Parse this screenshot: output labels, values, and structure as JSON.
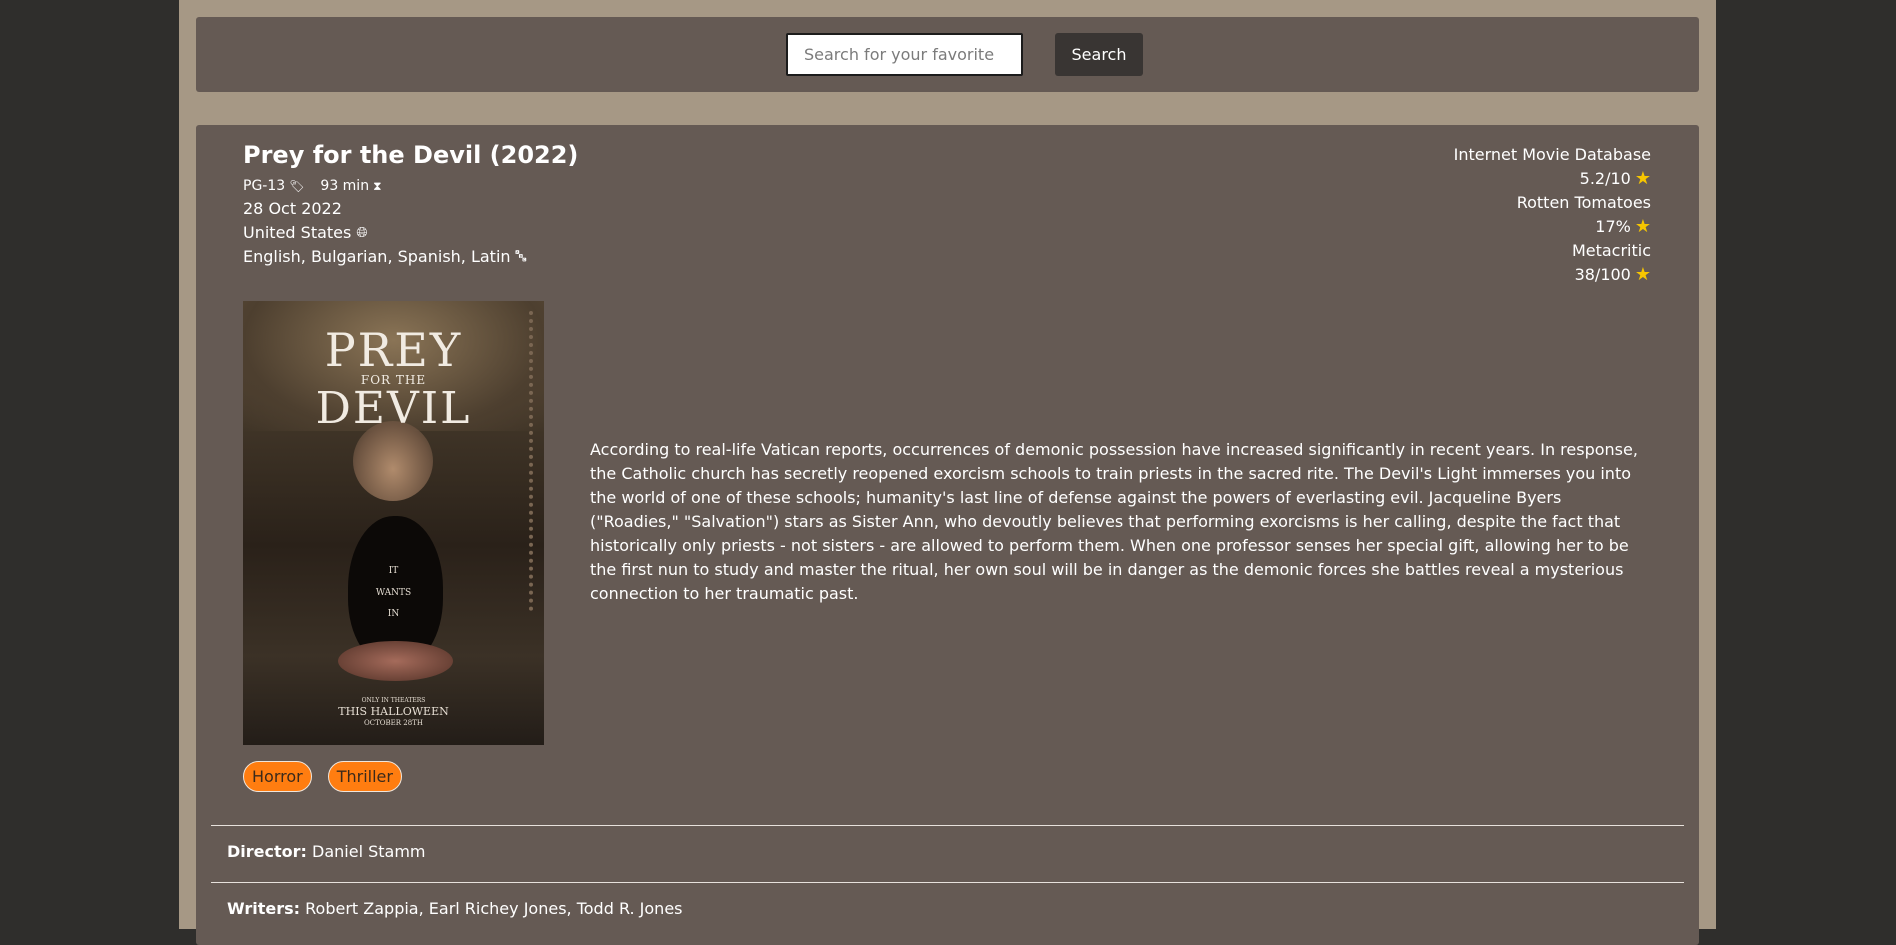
{
  "search": {
    "placeholder": "Search for your favorite",
    "value": "",
    "button_label": "Search"
  },
  "movie": {
    "title": "Prey for the Devil (2022)",
    "rated": "PG-13",
    "runtime": "93 min",
    "released": "28 Oct 2022",
    "country": "United States",
    "languages": "English, Bulgarian, Spanish, Latin",
    "plot": "According to real-life Vatican reports, occurrences of demonic possession have increased significantly in recent years. In response, the Catholic church has secretly reopened exorcism schools to train priests in the sacred rite. The Devil's Light immerses you into the world of one of these schools; humanity's last line of defense against the powers of everlasting evil. Jacqueline Byers (\"Roadies,\" \"Salvation\") stars as Sister Ann, who devoutly believes that performing exorcisms is her calling, despite the fact that historically only priests - not sisters - are allowed to perform them. When one professor senses her special gift, allowing her to be the first nun to study and master the ritual, her own soul will be in danger as the demonic forces she battles reveal a mysterious connection to her traumatic past.",
    "genres": [
      "Horror",
      "Thriller"
    ],
    "director_label": "Director:",
    "director": "Daniel Stamm",
    "writers_label": "Writers:",
    "writers": "Robert Zappia, Earl Richey Jones, Todd R. Jones"
  },
  "poster": {
    "title_line1": "PREY",
    "title_line2": "FOR THE",
    "title_line3": "DEVIL",
    "tagline": [
      "IT",
      "WANTS",
      "IN"
    ],
    "bottom_small": "ONLY IN THEATERS",
    "bottom_main": "THIS HALLOWEEN",
    "bottom_date": "OCTOBER 28TH"
  },
  "ratings": [
    {
      "source": "Internet Movie Database",
      "value": "5.2/10"
    },
    {
      "source": "Rotten Tomatoes",
      "value": "17%"
    },
    {
      "source": "Metacritic",
      "value": "38/100"
    }
  ],
  "icons": {
    "rated": "person-badge-icon",
    "runtime": "hourglass-icon",
    "country": "globe-icon",
    "language": "translate-icon",
    "rating": "star-icon"
  },
  "colors": {
    "page_bg": "#2f2e2c",
    "frame": "#a69885",
    "panel": "#655a54",
    "genre_tag": "#ff7d10",
    "star": "#f7c600",
    "search_button": "#393533"
  }
}
